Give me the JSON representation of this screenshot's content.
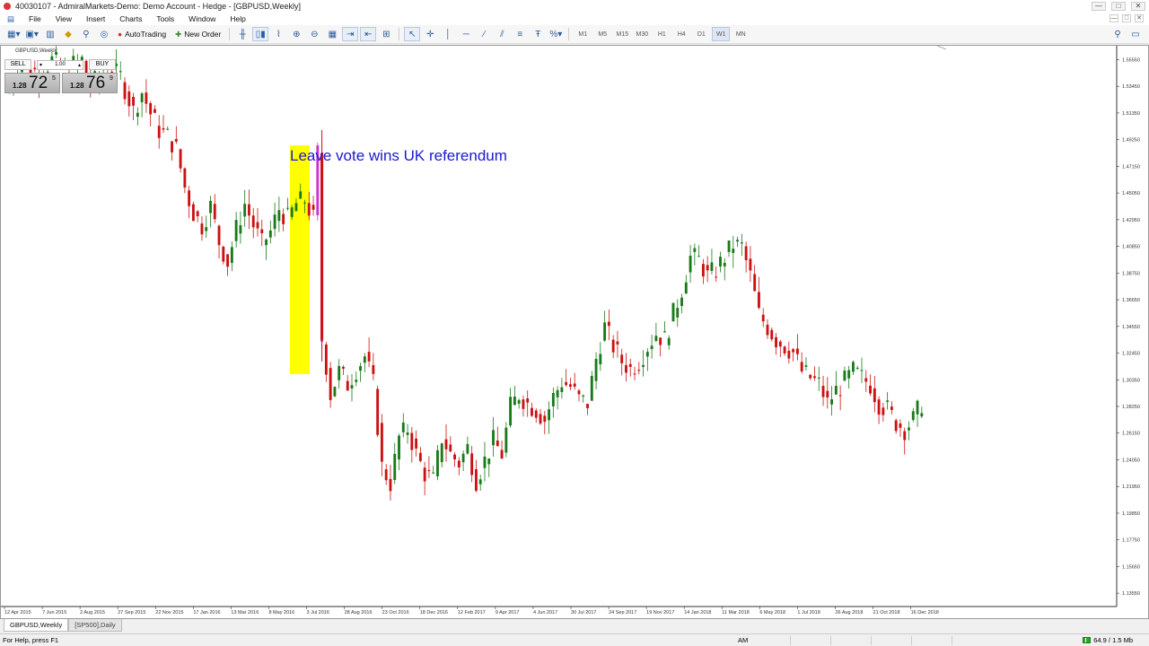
{
  "window": {
    "title": "40030107 - AdmiralMarkets-Demo: Demo Account - Hedge - [GBPUSD,Weekly]",
    "controls": [
      "—",
      "□",
      "✕"
    ]
  },
  "menu": [
    "File",
    "View",
    "Insert",
    "Charts",
    "Tools",
    "Window",
    "Help"
  ],
  "toolbar": {
    "autotrading": "AutoTrading",
    "new_order": "New Order",
    "timeframes": [
      "M1",
      "M5",
      "M15",
      "M30",
      "H1",
      "H4",
      "D1",
      "W1",
      "MN"
    ],
    "active_timeframe": "W1"
  },
  "chart": {
    "symbol_label": "GBPUSD,Weekly",
    "one_click": {
      "sell_label": "SELL",
      "buy_label": "BUY",
      "lot": "1.00",
      "sell_small": "1.28",
      "sell_big": "72",
      "sell_sup": "5",
      "buy_small": "1.28",
      "buy_big": "76",
      "buy_sup": "9"
    },
    "annotation": "Leave vote wins UK referendum",
    "highlight_color": "#ffff00",
    "bull_color": "#1a7a1a",
    "bear_color": "#cc1111",
    "vote_candle_color": "#cc33cc"
  },
  "chart_data": {
    "type": "candlestick",
    "symbol": "GBPUSD",
    "timeframe": "Weekly",
    "y_ticks": [
      "1.55550",
      "1.53450",
      "1.51350",
      "1.49250",
      "1.47150",
      "1.45050",
      "1.42950",
      "1.40850",
      "1.38750",
      "1.36650",
      "1.34550",
      "1.32450",
      "1.30350",
      "1.28250",
      "1.26150",
      "1.24050",
      "1.21950",
      "1.19850",
      "1.17750",
      "1.15650",
      "1.13550"
    ],
    "x_ticks": [
      "12 Apr 2015",
      "7 Jun 2015",
      "2 Aug 2015",
      "27 Sep 2015",
      "22 Nov 2015",
      "17 Jan 2016",
      "13 Mar 2016",
      "8 May 2016",
      "3 Jul 2016",
      "28 Aug 2016",
      "23 Oct 2016",
      "18 Dec 2016",
      "12 Feb 2017",
      "9 Apr 2017",
      "4 Jun 2017",
      "30 Jul 2017",
      "24 Sep 2017",
      "19 Nov 2017",
      "14 Jan 2018",
      "11 Mar 2018",
      "6 May 2018",
      "1 Jul 2018",
      "26 Aug 2018",
      "21 Oct 2018",
      "16 Dec 2018"
    ],
    "ylim": [
      1.125,
      1.565
    ],
    "close_path": [
      [
        0,
        1.53
      ],
      [
        4,
        1.552
      ],
      [
        8,
        1.545
      ],
      [
        11,
        1.555
      ],
      [
        14,
        1.548
      ],
      [
        18,
        1.555
      ],
      [
        20,
        1.535
      ],
      [
        24,
        1.548
      ],
      [
        27,
        1.542
      ],
      [
        30,
        1.515
      ],
      [
        32,
        1.53
      ],
      [
        34,
        1.513
      ],
      [
        36,
        1.5
      ],
      [
        38,
        1.495
      ],
      [
        40,
        1.485
      ],
      [
        42,
        1.455
      ],
      [
        44,
        1.435
      ],
      [
        46,
        1.425
      ],
      [
        48,
        1.44
      ],
      [
        50,
        1.412
      ],
      [
        52,
        1.396
      ],
      [
        54,
        1.422
      ],
      [
        56,
        1.442
      ],
      [
        58,
        1.425
      ],
      [
        60,
        1.41
      ],
      [
        62,
        1.42
      ],
      [
        64,
        1.438
      ],
      [
        66,
        1.43
      ],
      [
        68,
        1.442
      ],
      [
        70,
        1.445
      ],
      [
        72,
        1.43
      ],
      [
        73,
        1.482
      ],
      [
        74,
        1.335
      ],
      [
        75,
        1.315
      ],
      [
        76,
        1.292
      ],
      [
        78,
        1.31
      ],
      [
        80,
        1.3
      ],
      [
        82,
        1.312
      ],
      [
        84,
        1.322
      ],
      [
        86,
        1.3
      ],
      [
        88,
        1.235
      ],
      [
        90,
        1.222
      ],
      [
        92,
        1.258
      ],
      [
        94,
        1.265
      ],
      [
        96,
        1.245
      ],
      [
        98,
        1.23
      ],
      [
        100,
        1.224
      ],
      [
        102,
        1.258
      ],
      [
        104,
        1.245
      ],
      [
        106,
        1.238
      ],
      [
        108,
        1.25
      ],
      [
        110,
        1.225
      ],
      [
        112,
        1.24
      ],
      [
        114,
        1.255
      ],
      [
        116,
        1.245
      ],
      [
        118,
        1.282
      ],
      [
        120,
        1.292
      ],
      [
        122,
        1.285
      ],
      [
        124,
        1.28
      ],
      [
        126,
        1.272
      ],
      [
        128,
        1.29
      ],
      [
        130,
        1.302
      ],
      [
        132,
        1.298
      ],
      [
        134,
        1.288
      ],
      [
        136,
        1.285
      ],
      [
        138,
        1.32
      ],
      [
        140,
        1.345
      ],
      [
        142,
        1.33
      ],
      [
        144,
        1.318
      ],
      [
        146,
        1.312
      ],
      [
        148,
        1.318
      ],
      [
        150,
        1.33
      ],
      [
        152,
        1.34
      ],
      [
        154,
        1.335
      ],
      [
        156,
        1.355
      ],
      [
        158,
        1.375
      ],
      [
        160,
        1.4
      ],
      [
        162,
        1.398
      ],
      [
        164,
        1.385
      ],
      [
        166,
        1.39
      ],
      [
        168,
        1.4
      ],
      [
        170,
        1.41
      ],
      [
        172,
        1.408
      ],
      [
        174,
        1.385
      ],
      [
        176,
        1.355
      ],
      [
        178,
        1.345
      ],
      [
        180,
        1.335
      ],
      [
        182,
        1.33
      ],
      [
        184,
        1.325
      ],
      [
        186,
        1.31
      ],
      [
        188,
        1.305
      ],
      [
        190,
        1.3
      ],
      [
        192,
        1.285
      ],
      [
        194,
        1.295
      ],
      [
        196,
        1.302
      ],
      [
        198,
        1.31
      ],
      [
        200,
        1.305
      ],
      [
        202,
        1.3
      ],
      [
        204,
        1.285
      ],
      [
        206,
        1.28
      ],
      [
        208,
        1.27
      ],
      [
        210,
        1.265
      ],
      [
        212,
        1.272
      ],
      [
        214,
        1.285
      ]
    ]
  },
  "tabs": [
    "GBPUSD,Weekly",
    "[SP500],Daily"
  ],
  "status": {
    "help": "For Help, press F1",
    "profile": "AM",
    "connection": "64.9 / 1.5 Mb"
  }
}
